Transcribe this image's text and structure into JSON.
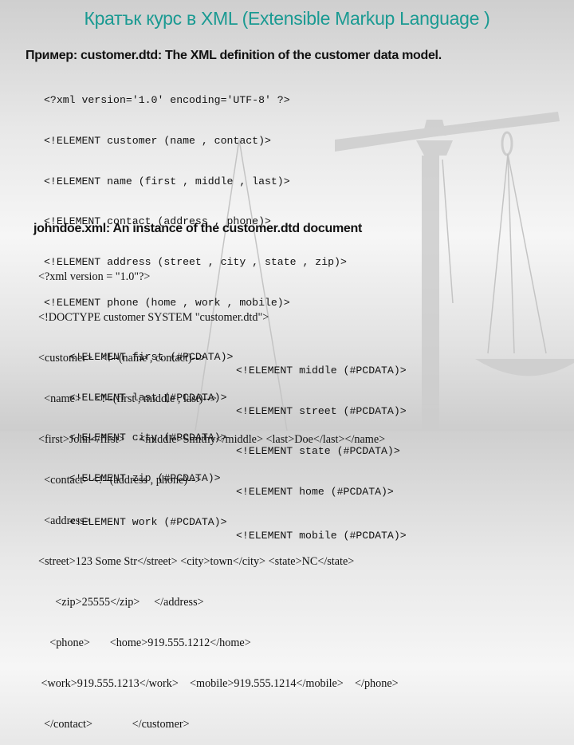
{
  "title": "Кратък курс в XML (Extensible Markup Language )",
  "section1": {
    "heading": "Пример:  customer.dtd: The XML definition of the customer data model.",
    "lines": [
      "<?xml version='1.0' encoding='UTF-8' ?>",
      "<!ELEMENT customer (name , contact)>",
      "<!ELEMENT name (first , middle , last)>",
      "<!ELEMENT contact (address , phone)>",
      "<!ELEMENT address (street , city , state , zip)>",
      "<!ELEMENT phone (home , work , mobile)>"
    ],
    "pairs": [
      {
        "left": "<!ELEMENT first (#PCDATA)>",
        "right": "<!ELEMENT middle (#PCDATA)>"
      },
      {
        "left": "<!ELEMENT last (#PCDATA)>",
        "right": "<!ELEMENT street (#PCDATA)>"
      },
      {
        "left": "<!ELEMENT city (#PCDATA)>",
        "right": "<!ELEMENT state (#PCDATA)>"
      },
      {
        "left": "<!ELEMENT zip (#PCDATA)>",
        "right": "<!ELEMENT home (#PCDATA)>"
      },
      {
        "left": "<!ELEMENT work (#PCDATA)>",
        "right": "<!ELEMENT mobile (#PCDATA)>"
      }
    ]
  },
  "section2": {
    "heading": "johndoe.xml: An instance of the customer.dtd document",
    "lines": [
      "<?xml version = \"1.0\"?>",
      "<!DOCTYPE customer SYSTEM \"customer.dtd\">",
      "<customer>   <!--(name , contact)-->",
      "  <name>     <!--(first , middle , last)-->",
      "<first>John</first>     <middle>Smithy</middle> <last>Doe</last></name>",
      "  <contact> <!--(address , phone)-->",
      "  <address>",
      "<street>123 Some Str</street> <city>town</city> <state>NC</state>",
      "      <zip>25555</zip>     </address>",
      "    <phone>       <home>919.555.1212</home>",
      " <work>919.555.1213</work>    <mobile>919.555.1214</mobile>    </phone>",
      "  </contact>              </customer>"
    ]
  }
}
